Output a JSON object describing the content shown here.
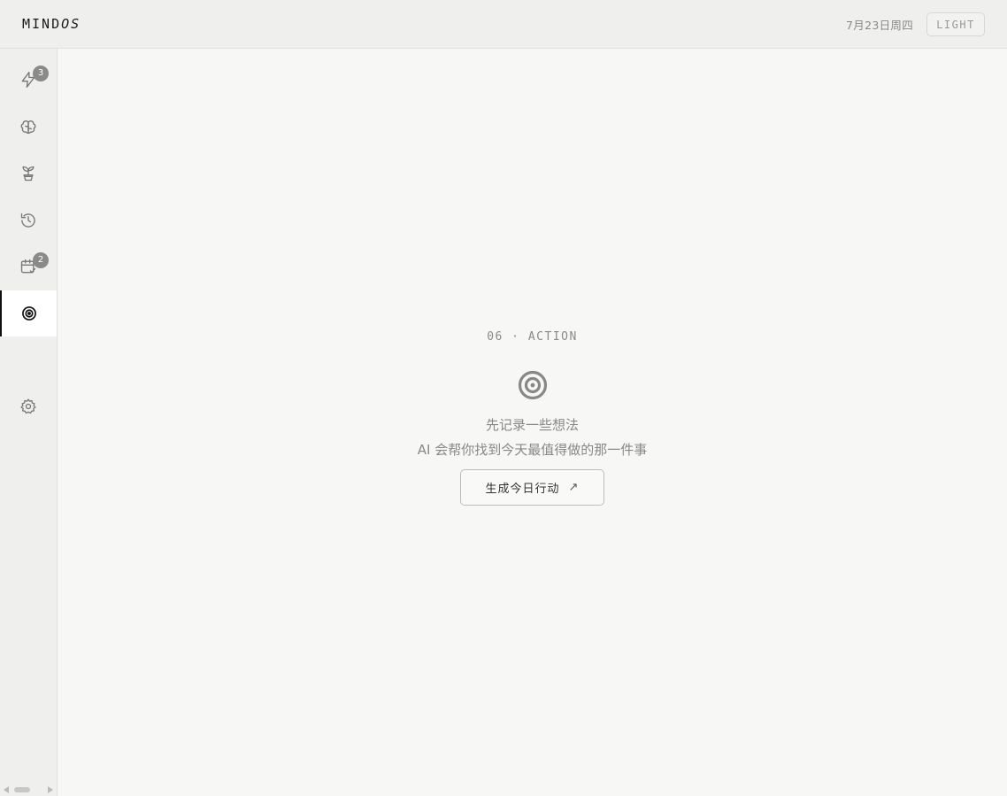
{
  "header": {
    "logo_main": "MIND",
    "logo_italic": "OS",
    "date": "7月23日周四",
    "theme_toggle": "LIGHT"
  },
  "sidebar": {
    "items": [
      {
        "icon": "lightning-icon",
        "badge": "3"
      },
      {
        "icon": "brain-icon",
        "badge": ""
      },
      {
        "icon": "plant-icon",
        "badge": ""
      },
      {
        "icon": "history-icon",
        "badge": ""
      },
      {
        "icon": "calendar-check-icon",
        "badge": "2"
      },
      {
        "icon": "target-icon",
        "badge": "",
        "active": true
      },
      {
        "icon": "gear-icon",
        "badge": ""
      }
    ]
  },
  "main": {
    "section_tag": "06 · ACTION",
    "empty_line1": "先记录一些想法",
    "empty_line2": "AI 会帮你找到今天最值得做的那一件事",
    "generate_button": "生成今日行动",
    "generate_arrow": "↗"
  },
  "colors": {
    "background": "#f7f7f5",
    "sidebar": "#efefed",
    "badge": "#8a8a8a",
    "active_indicator": "#111111"
  }
}
